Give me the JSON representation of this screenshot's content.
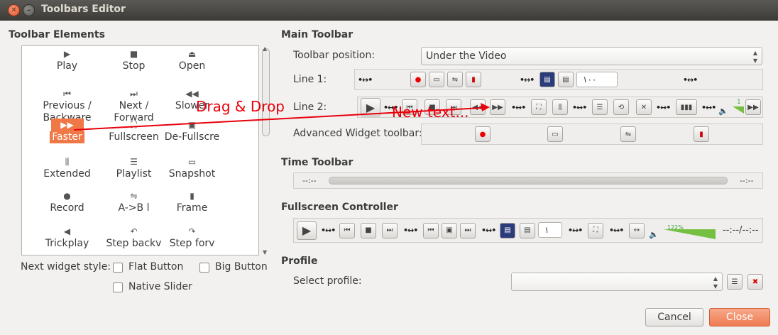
{
  "window": {
    "title": "Toolbars Editor"
  },
  "left": {
    "heading": "Toolbar Elements",
    "elements": [
      {
        "label": "Play",
        "icon": "play-icon",
        "glyph": "▶"
      },
      {
        "label": "Stop",
        "icon": "stop-icon",
        "glyph": "■"
      },
      {
        "label": "Open",
        "icon": "eject-icon",
        "glyph": "⏏"
      },
      {
        "label": "Previous / Backware",
        "icon": "previous-icon",
        "glyph": "⏮"
      },
      {
        "label": "Next / Forward",
        "icon": "next-icon",
        "glyph": "⏭"
      },
      {
        "label": "Slower",
        "icon": "slower-icon",
        "glyph": "◀◀"
      },
      {
        "label": "Faster",
        "icon": "faster-icon",
        "glyph": "▶▶"
      },
      {
        "label": "Fullscreen",
        "icon": "fullscreen-icon",
        "glyph": "⛶"
      },
      {
        "label": "De-Fullscre",
        "icon": "defullscreen-icon",
        "glyph": "▣"
      },
      {
        "label": "Extended",
        "icon": "extended-icon",
        "glyph": "⫼"
      },
      {
        "label": "Playlist",
        "icon": "playlist-icon",
        "glyph": "☰"
      },
      {
        "label": "Snapshot",
        "icon": "snapshot-icon",
        "glyph": "▭"
      },
      {
        "label": "Record",
        "icon": "record-icon",
        "glyph": "●"
      },
      {
        "label": "A->B l",
        "icon": "ab-loop-icon",
        "glyph": "⇋"
      },
      {
        "label": "Frame",
        "icon": "frame-icon",
        "glyph": "▮"
      },
      {
        "label": "Trickplay",
        "icon": "trickplay-icon",
        "glyph": "◀"
      },
      {
        "label": "Step backv",
        "icon": "step-back-icon",
        "glyph": "↶"
      },
      {
        "label": "Step forv",
        "icon": "step-forward-icon",
        "glyph": "↷"
      }
    ],
    "next_widget_style_label": "Next widget style:",
    "flat_button": "Flat Button",
    "big_button": "Big Button",
    "native_slider": "Native Slider"
  },
  "main_toolbar": {
    "heading": "Main Toolbar",
    "position_label": "Toolbar position:",
    "position_value": "Under the Video",
    "line1_label": "Line 1:",
    "line2_label": "Line 2:",
    "advanced_label": "Advanced Widget toolbar:",
    "line1_spin": "١٠٠",
    "volume_value": "1"
  },
  "time_toolbar": {
    "heading": "Time Toolbar",
    "left_time": "--:--",
    "right_time": "--:--"
  },
  "fullscreen_controller": {
    "heading": "Fullscreen Controller",
    "spin": "١",
    "volume_percent": "122%",
    "time": "--:--/--:--"
  },
  "profile": {
    "heading": "Profile",
    "select_label": "Select profile:"
  },
  "buttons": {
    "cancel": "Cancel",
    "close": "Close"
  },
  "overlay": {
    "drag_drop": "Drag & Drop",
    "new_text": "New text..."
  },
  "colors": {
    "accent": "#f07746",
    "annotation": "#e8000b"
  }
}
